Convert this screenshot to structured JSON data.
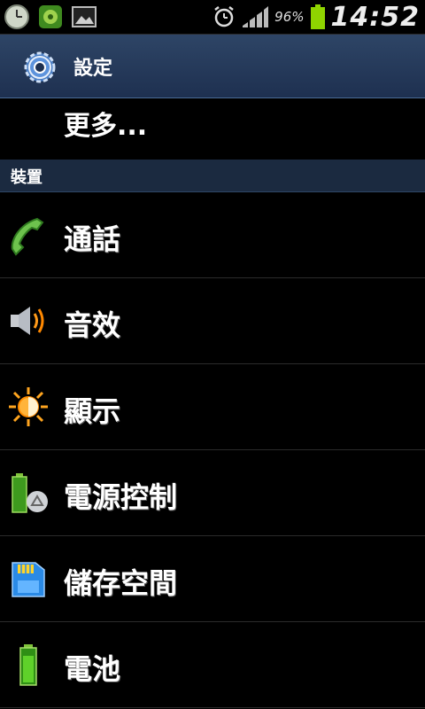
{
  "status_bar": {
    "battery_percent": "96%",
    "time": "14:52",
    "icons": [
      "clock-app-icon",
      "app-notification-icon",
      "gallery-icon",
      "alarm-icon",
      "signal-icon",
      "battery-icon"
    ]
  },
  "header": {
    "title": "設定",
    "icon": "settings-gear-icon"
  },
  "more_item": {
    "label": "更多..."
  },
  "section": {
    "label": "裝置"
  },
  "items": [
    {
      "label": "通話",
      "icon": "phone-icon"
    },
    {
      "label": "音效",
      "icon": "speaker-icon"
    },
    {
      "label": "顯示",
      "icon": "brightness-icon"
    },
    {
      "label": "電源控制",
      "icon": "power-saving-icon"
    },
    {
      "label": "儲存空間",
      "icon": "storage-icon"
    },
    {
      "label": "電池",
      "icon": "battery-icon"
    }
  ],
  "colors": {
    "header_bg": "#253a5a",
    "section_bg": "#1b2a40",
    "background": "#000000"
  }
}
